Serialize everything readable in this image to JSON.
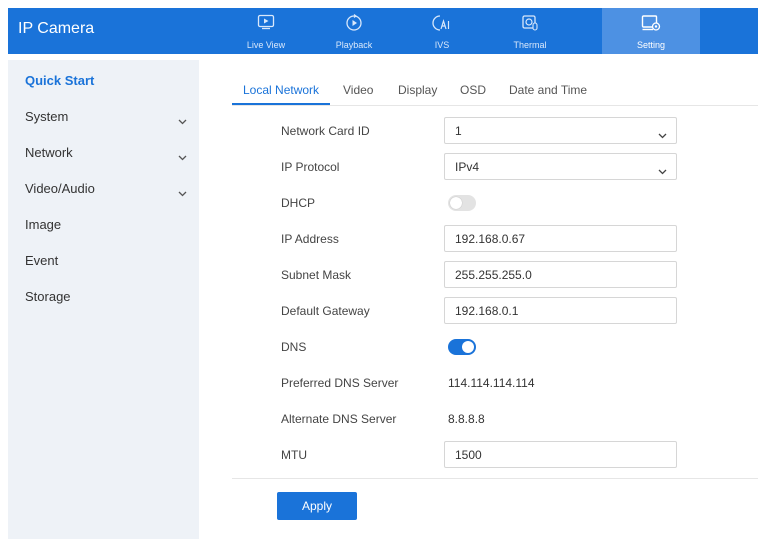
{
  "app": {
    "title": "IP Camera"
  },
  "topnav": [
    {
      "label": "Live View",
      "icon": "live-view-icon"
    },
    {
      "label": "Playback",
      "icon": "playback-icon"
    },
    {
      "label": "IVS",
      "icon": "ivs-icon"
    },
    {
      "label": "Thermal",
      "icon": "thermal-icon"
    },
    {
      "label": "Setting",
      "icon": "setting-icon",
      "active": true
    }
  ],
  "sidebar": {
    "items": [
      {
        "label": "Quick Start",
        "active": true
      },
      {
        "label": "System",
        "expandable": true
      },
      {
        "label": "Network",
        "expandable": true
      },
      {
        "label": "Video/Audio",
        "expandable": true
      },
      {
        "label": "Image"
      },
      {
        "label": "Event"
      },
      {
        "label": "Storage"
      }
    ]
  },
  "tabs": [
    {
      "label": "Local Network",
      "active": true
    },
    {
      "label": "Video"
    },
    {
      "label": "Display"
    },
    {
      "label": "OSD"
    },
    {
      "label": "Date and Time"
    }
  ],
  "form": {
    "network_card_id": {
      "label": "Network Card ID",
      "value": "1"
    },
    "ip_protocol": {
      "label": "IP Protocol",
      "value": "IPv4"
    },
    "dhcp": {
      "label": "DHCP",
      "enabled": false
    },
    "ip_address": {
      "label": "IP Address",
      "value": "192.168.0.67"
    },
    "subnet_mask": {
      "label": "Subnet Mask",
      "value": "255.255.255.0"
    },
    "default_gateway": {
      "label": "Default Gateway",
      "value": "192.168.0.1"
    },
    "dns": {
      "label": "DNS",
      "enabled": true
    },
    "preferred_dns": {
      "label": "Preferred DNS Server",
      "value": "114.114.114.114"
    },
    "alternate_dns": {
      "label": "Alternate DNS Server",
      "value": "8.8.8.8"
    },
    "mtu": {
      "label": "MTU",
      "value": "1500"
    }
  },
  "actions": {
    "apply_label": "Apply"
  },
  "colors": {
    "accent": "#1a73d9",
    "sidebar_bg": "#eef2f7",
    "active_nav_bg": "#4d91e3"
  }
}
